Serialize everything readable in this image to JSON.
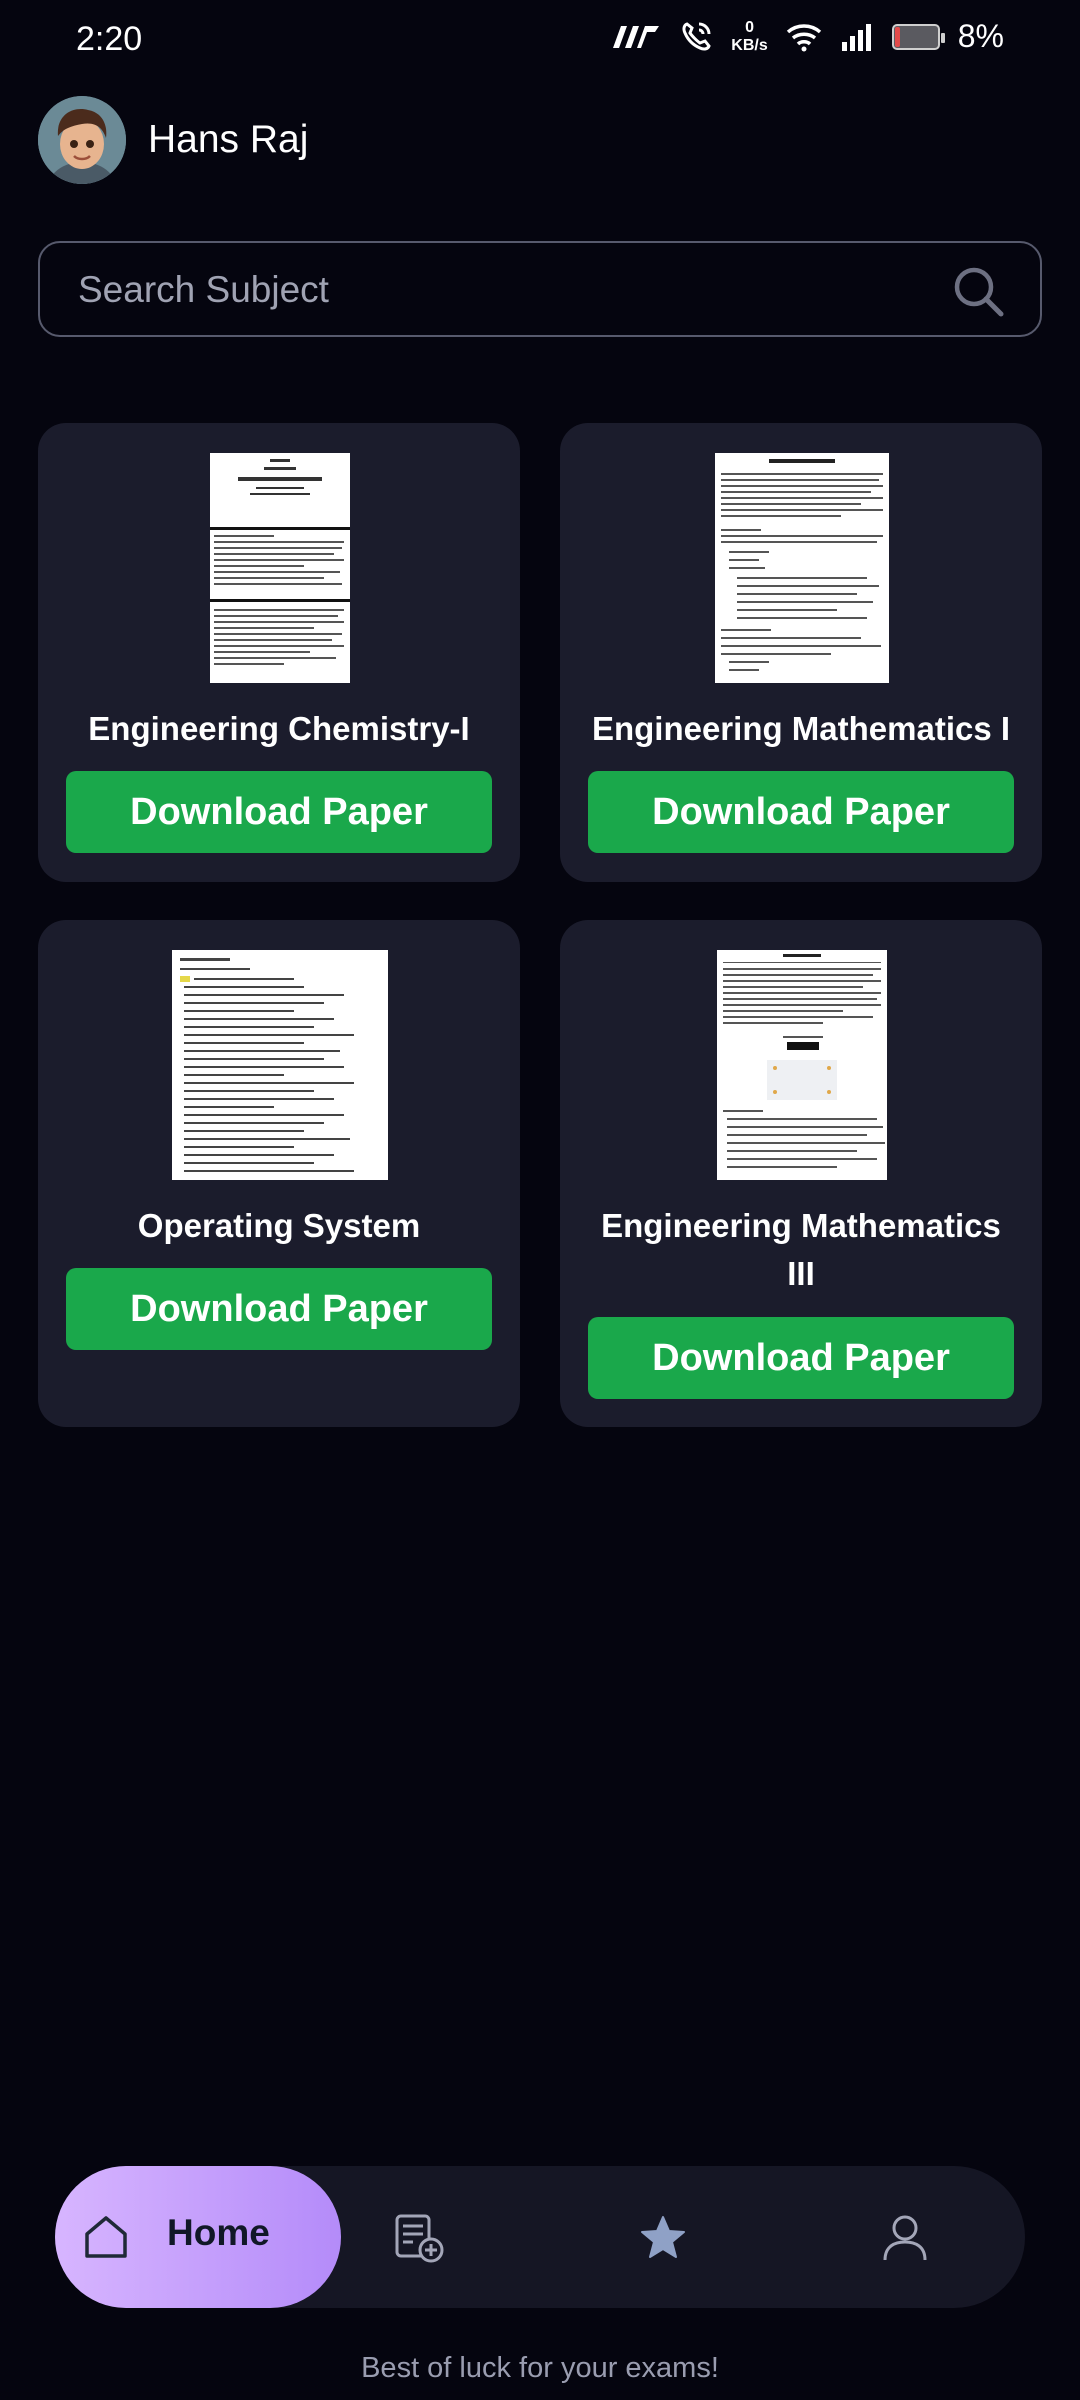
{
  "status_bar": {
    "time": "2:20",
    "data_speed_value": "0",
    "data_speed_unit": "KB/s",
    "battery": "8%"
  },
  "profile": {
    "name": "Hans Raj"
  },
  "search": {
    "placeholder": "Search Subject"
  },
  "subjects": [
    {
      "title": "Engineering Chemistry-I",
      "button": "Download Paper"
    },
    {
      "title": "Engineering Mathematics I",
      "button": "Download Paper"
    },
    {
      "title": "Operating System",
      "button": "Download Paper"
    },
    {
      "title": "Engineering Mathematics III",
      "button": "Download Paper"
    }
  ],
  "bottom_nav": {
    "items": [
      {
        "label": "Home",
        "icon": "home-icon",
        "active": true
      },
      {
        "label": "",
        "icon": "add-paper-icon"
      },
      {
        "label": "",
        "icon": "star-icon"
      },
      {
        "label": "",
        "icon": "profile-icon"
      }
    ]
  },
  "footer": {
    "message": "Best of luck for your exams!"
  },
  "colors": {
    "background": "#05050f",
    "card": "#1b1c2c",
    "accent_green": "#1aa84b",
    "nav_active": "#c9a3fd"
  }
}
